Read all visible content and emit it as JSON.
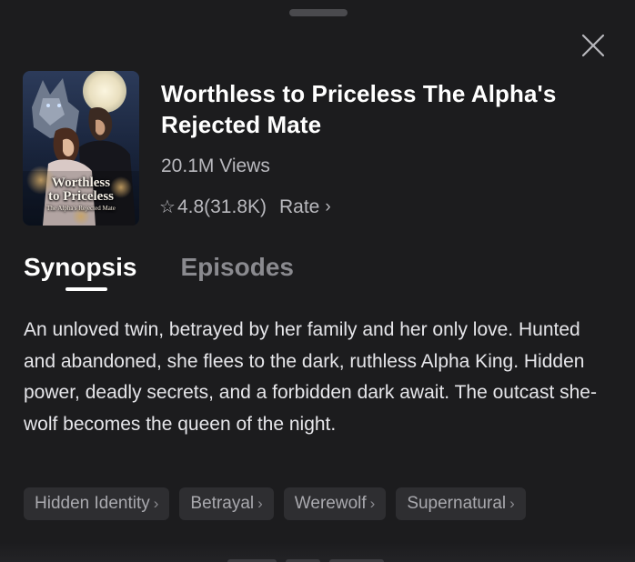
{
  "book": {
    "title": "Worthless to Priceless The Alpha's Rejected Mate",
    "views": "20.1M Views",
    "rating": "4.8(31.8K)",
    "rate_label": "Rate",
    "cover": {
      "line1": "Worthless",
      "line2": "to Priceless",
      "line3": "The Alpha's Rejected Mate"
    }
  },
  "tabs": [
    {
      "label": "Synopsis",
      "active": true
    },
    {
      "label": "Episodes",
      "active": false
    }
  ],
  "synopsis": "An unloved twin, betrayed by her family and her only love. Hunted and abandoned, she flees to the dark, ruthless Alpha King. Hidden power, deadly secrets, and a forbidden dark await. The outcast she-wolf becomes the queen of the night.",
  "tags": [
    {
      "label": "Hidden Identity"
    },
    {
      "label": "Betrayal"
    },
    {
      "label": "Werewolf"
    },
    {
      "label": "Supernatural"
    }
  ],
  "icons": {
    "close": "close-icon",
    "star": "star-icon",
    "chevron": "chevron-right-icon"
  },
  "colors": {
    "background": "#1c1c1e",
    "tag_background": "#2e2e31",
    "text_primary": "#ffffff",
    "text_secondary": "#b9b9be"
  }
}
